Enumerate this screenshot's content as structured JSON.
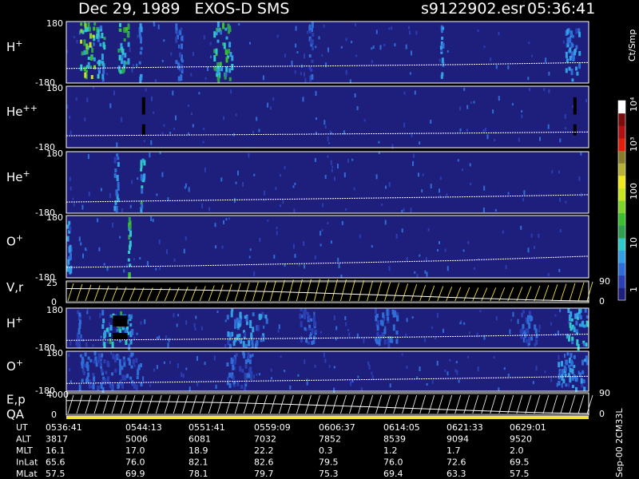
{
  "header": {
    "title": "Dec 29, 1989   EXOS-D SMS",
    "file": "s9122902.esr",
    "time": "05:36:41"
  },
  "colorbar": {
    "unit": "Ct/Smp",
    "colors": [
      "#1e1e7c",
      "#2a3fb4",
      "#2f6ed8",
      "#33a0e6",
      "#2fc9c9",
      "#2ea050",
      "#3bbf2f",
      "#7fd42a",
      "#c8e620",
      "#f0e81e",
      "#b8b036",
      "#8a7a2c",
      "#e0200a",
      "#b01212",
      "#7a0c0c",
      "#ffffff"
    ]
  },
  "chart_data": [
    {
      "type": "heatmap",
      "name": "H+",
      "label_base": "H",
      "label_sup": "+",
      "ylim": [
        -180,
        180
      ],
      "ticks": [
        "180",
        "-180"
      ],
      "activity": [
        {
          "t0": "05:38:10",
          "t1": "05:39:55",
          "level": 7
        },
        {
          "t0": "05:39:55",
          "t1": "05:41:00",
          "level": 4
        },
        {
          "t0": "05:42:15",
          "t1": "05:43:40",
          "level": 5
        },
        {
          "t0": "05:44:30",
          "t1": "05:45:00",
          "level": 3
        },
        {
          "t0": "05:48:30",
          "t1": "05:49:30",
          "level": 2
        },
        {
          "t0": "05:52:40",
          "t1": "05:55:00",
          "level": 5
        },
        {
          "t0": "06:03:00",
          "t1": "06:03:40",
          "level": 2
        },
        {
          "t0": "06:17:20",
          "t1": "06:17:50",
          "level": 3
        },
        {
          "t0": "06:30:55",
          "t1": "06:32:45",
          "level": 3
        }
      ],
      "angle_curve": [
        -95,
        -85,
        -80,
        -72,
        -60
      ]
    },
    {
      "type": "heatmap",
      "name": "He++",
      "label_base": "He",
      "label_sup": "++",
      "ylim": [
        -180,
        180
      ],
      "ticks": [
        "180",
        "-180"
      ],
      "activity": [
        {
          "t0": "05:44:55",
          "t1": "05:45:10",
          "level": -1
        },
        {
          "t0": "06:31:50",
          "t1": "06:32:05",
          "level": -1
        }
      ],
      "angle_curve": [
        -110,
        -105,
        -100,
        -95,
        -88
      ]
    },
    {
      "type": "heatmap",
      "name": "He+",
      "label_base": "He",
      "label_sup": "+",
      "ylim": [
        -180,
        180
      ],
      "ticks": [
        "180",
        "-180"
      ],
      "activity": [
        {
          "t0": "05:41:50",
          "t1": "05:42:30",
          "level": 3
        },
        {
          "t0": "05:44:40",
          "t1": "05:45:20",
          "level": 4
        }
      ],
      "angle_curve": [
        -115,
        -105,
        -95,
        -85,
        -72
      ]
    },
    {
      "type": "heatmap",
      "name": "O+",
      "label_base": "O",
      "label_sup": "+",
      "ylim": [
        -180,
        180
      ],
      "ticks": [
        "180",
        "-180"
      ],
      "activity": [
        {
          "t0": "05:36:41",
          "t1": "05:37:20",
          "level": 3
        },
        {
          "t0": "05:43:20",
          "t1": "05:43:50",
          "level": 6
        }
      ],
      "angle_curve": [
        -120,
        -110,
        -95,
        -80,
        -55
      ]
    },
    {
      "type": "line",
      "name": "V,r",
      "ylim": [
        0,
        25
      ],
      "ticks": [
        "25",
        "0"
      ],
      "right_ticks": [
        "90",
        "0"
      ]
    },
    {
      "type": "heatmap",
      "name": "H+ (lower)",
      "label_base": "H",
      "label_sup": "+",
      "ylim": [
        -180,
        180
      ],
      "ticks": [
        "180",
        "-180"
      ],
      "activity": [
        {
          "t0": "05:37:40",
          "t1": "05:38:20",
          "level": 2
        },
        {
          "t0": "05:40:30",
          "t1": "05:44:00",
          "level": 4
        },
        {
          "t0": "05:41:45",
          "t1": "05:43:20",
          "level": -1
        },
        {
          "t0": "05:54:00",
          "t1": "05:58:40",
          "level": 3
        },
        {
          "t0": "06:02:00",
          "t1": "06:04:00",
          "level": 2
        },
        {
          "t0": "06:10:00",
          "t1": "06:13:00",
          "level": 2
        },
        {
          "t0": "06:26:00",
          "t1": "06:28:00",
          "level": 2
        },
        {
          "t0": "06:31:00",
          "t1": "06:33:30",
          "level": 4
        }
      ],
      "angle_curve": [
        -110,
        -100,
        -90,
        -75,
        -55
      ]
    },
    {
      "type": "heatmap",
      "name": "O+ (lower)",
      "label_base": "O",
      "label_sup": "+",
      "ylim": [
        -180,
        180
      ],
      "ticks": [
        "180",
        "-180"
      ],
      "activity": [
        {
          "t0": "05:38:00",
          "t1": "05:45:00",
          "level": 2
        },
        {
          "t0": "05:54:00",
          "t1": "05:57:00",
          "level": 2
        },
        {
          "t0": "06:30:00",
          "t1": "06:33:30",
          "level": 3
        }
      ],
      "angle_curve": [
        -110,
        -95,
        -80,
        -65,
        -45
      ]
    },
    {
      "type": "line",
      "name": "E,p",
      "ylim": [
        0,
        4000
      ],
      "ticks": [
        "4000",
        "0"
      ],
      "right_ticks": [
        "90",
        "0"
      ]
    }
  ],
  "qa_label": "QA",
  "time_axis": {
    "start": "05:36:41",
    "end": "06:33:30",
    "row_labels": [
      "UT",
      "ALT",
      "MLT",
      "InLat",
      "MLat"
    ],
    "columns": [
      {
        "UT": "0536:41",
        "ALT": "3817",
        "MLT": "16.1",
        "InLat": "65.6",
        "MLat": "57.5"
      },
      {
        "UT": "0544:13",
        "ALT": "5006",
        "MLT": "17.0",
        "InLat": "76.0",
        "MLat": "69.9"
      },
      {
        "UT": "0551:41",
        "ALT": "6081",
        "MLT": "18.9",
        "InLat": "82.1",
        "MLat": "78.1"
      },
      {
        "UT": "0559:09",
        "ALT": "7032",
        "MLT": "22.2",
        "InLat": "82.6",
        "MLat": "79.7"
      },
      {
        "UT": "0606:37",
        "ALT": "7852",
        "MLT": "0.3",
        "InLat": "79.5",
        "MLat": "75.3"
      },
      {
        "UT": "0614:05",
        "ALT": "8539",
        "MLT": "1.2",
        "InLat": "76.0",
        "MLat": "69.4"
      },
      {
        "UT": "0621:33",
        "ALT": "9094",
        "MLT": "1.7",
        "InLat": "72.6",
        "MLat": "63.3"
      },
      {
        "UT": "0629:01",
        "ALT": "9520",
        "MLT": "2.0",
        "InLat": "69.5",
        "MLat": "57.5"
      }
    ]
  },
  "footer": {
    "version": "Sep-00 2CM33L"
  }
}
